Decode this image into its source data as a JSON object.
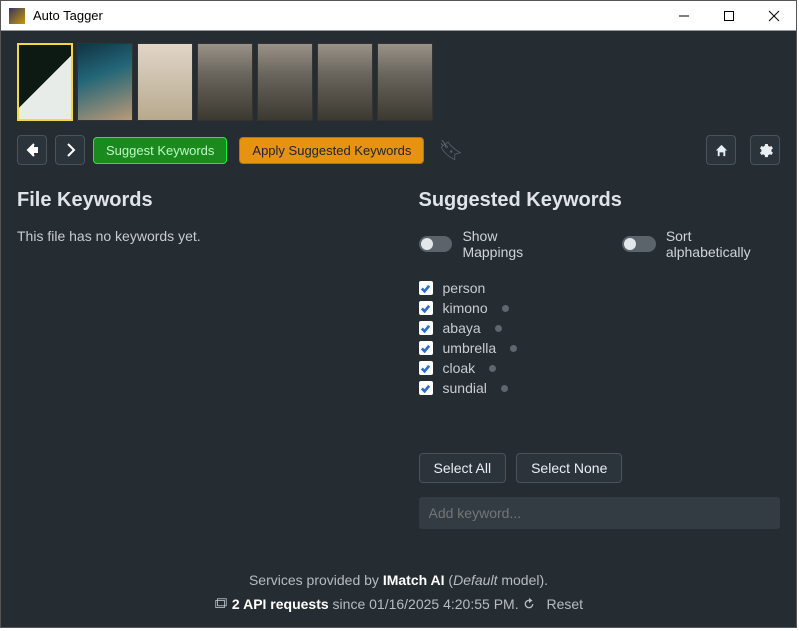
{
  "window": {
    "title": "Auto Tagger"
  },
  "toolbar": {
    "suggest_label": "Suggest Keywords",
    "apply_label": "Apply Suggested Keywords"
  },
  "file_keywords": {
    "heading": "File Keywords",
    "empty_msg": "This file has no keywords yet."
  },
  "suggested": {
    "heading": "Suggested Keywords",
    "toggle_mappings": "Show Mappings",
    "toggle_sort": "Sort alphabetically",
    "keywords": [
      {
        "label": "person",
        "checked": true,
        "dot": false
      },
      {
        "label": "kimono",
        "checked": true,
        "dot": true
      },
      {
        "label": "abaya",
        "checked": true,
        "dot": true
      },
      {
        "label": "umbrella",
        "checked": true,
        "dot": true
      },
      {
        "label": "cloak",
        "checked": true,
        "dot": true
      },
      {
        "label": "sundial",
        "checked": true,
        "dot": true
      }
    ],
    "select_all": "Select All",
    "select_none": "Select None",
    "add_placeholder": "Add keyword..."
  },
  "footer": {
    "line1_a": "Services provided by ",
    "line1_b": "IMatch AI",
    "line1_c": " (",
    "line1_model": "Default",
    "line1_d": " model).",
    "line2_count": "2 API requests",
    "line2_since": " since 01/16/2025 4:20:55 PM. ",
    "reset": "Reset"
  }
}
